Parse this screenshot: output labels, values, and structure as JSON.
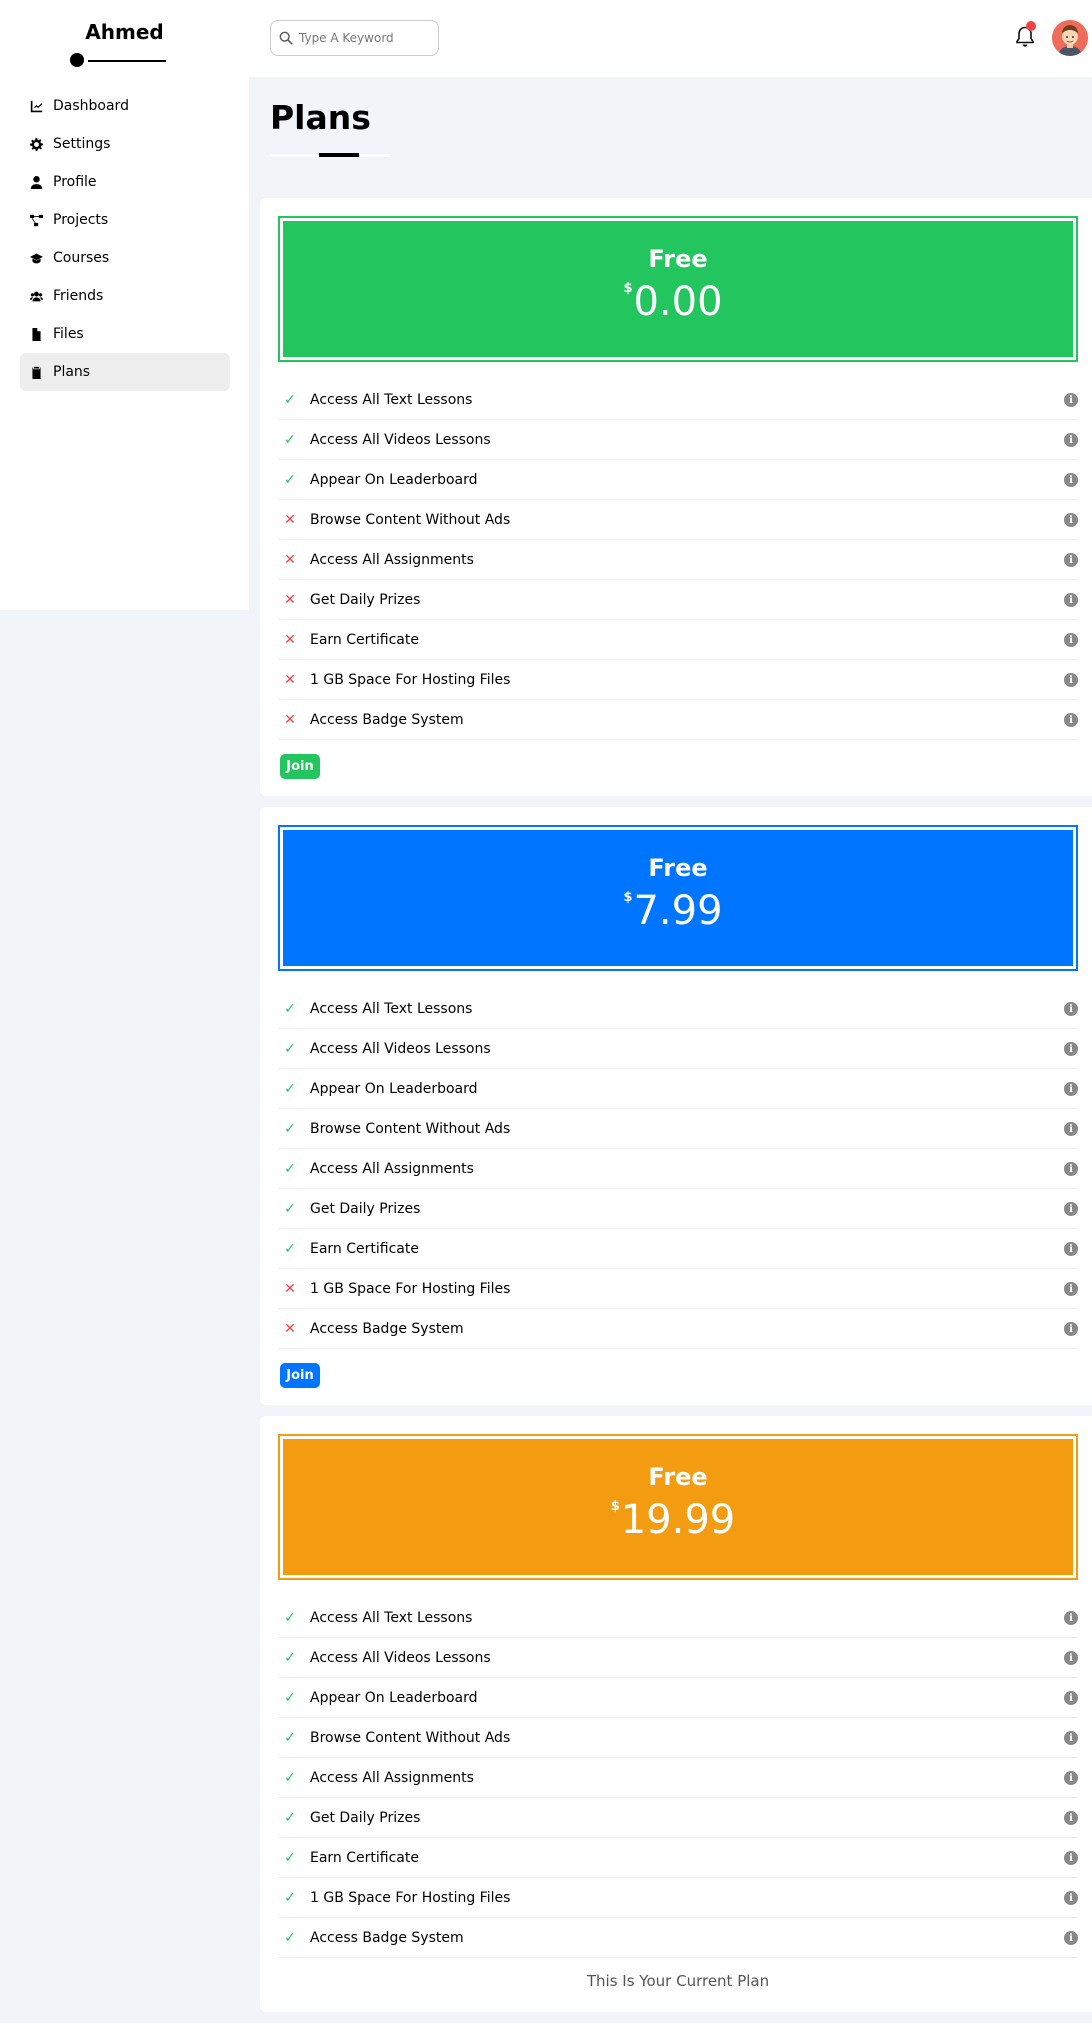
{
  "sidebar": {
    "brand": "Ahmed",
    "items": [
      {
        "label": "Dashboard",
        "icon": "chart-line-icon"
      },
      {
        "label": "Settings",
        "icon": "gear-icon"
      },
      {
        "label": "Profile",
        "icon": "user-icon"
      },
      {
        "label": "Projects",
        "icon": "diagram-icon"
      },
      {
        "label": "Courses",
        "icon": "graduation-cap-icon"
      },
      {
        "label": "Friends",
        "icon": "users-icon"
      },
      {
        "label": "Files",
        "icon": "file-icon"
      },
      {
        "label": "Plans",
        "icon": "clipboard-icon",
        "active": true
      }
    ]
  },
  "header": {
    "search_placeholder": "Type A Keyword",
    "notification_icon": "bell-icon",
    "avatar_icon": "avatar"
  },
  "main": {
    "title": "Plans",
    "plans": [
      {
        "name": "Free",
        "currency": "$",
        "price": "0.00",
        "color": "#22c55e",
        "features": [
          {
            "label": "Access All Text Lessons",
            "included": true
          },
          {
            "label": "Access All Videos Lessons",
            "included": true
          },
          {
            "label": "Appear On Leaderboard",
            "included": true
          },
          {
            "label": "Browse Content Without Ads",
            "included": false
          },
          {
            "label": "Access All Assignments",
            "included": false
          },
          {
            "label": "Get Daily Prizes",
            "included": false
          },
          {
            "label": "Earn Certificate",
            "included": false
          },
          {
            "label": "1 GB Space For Hosting Files",
            "included": false
          },
          {
            "label": "Access Badge System",
            "included": false
          }
        ],
        "action_label": "Join"
      },
      {
        "name": "Free",
        "currency": "$",
        "price": "7.99",
        "color": "#0075ff",
        "features": [
          {
            "label": "Access All Text Lessons",
            "included": true
          },
          {
            "label": "Access All Videos Lessons",
            "included": true
          },
          {
            "label": "Appear On Leaderboard",
            "included": true
          },
          {
            "label": "Browse Content Without Ads",
            "included": true
          },
          {
            "label": "Access All Assignments",
            "included": true
          },
          {
            "label": "Get Daily Prizes",
            "included": true
          },
          {
            "label": "Earn Certificate",
            "included": true
          },
          {
            "label": "1 GB Space For Hosting Files",
            "included": false
          },
          {
            "label": "Access Badge System",
            "included": false
          }
        ],
        "action_label": "Join"
      },
      {
        "name": "Free",
        "currency": "$",
        "price": "19.99",
        "color": "#f39c12",
        "features": [
          {
            "label": "Access All Text Lessons",
            "included": true
          },
          {
            "label": "Access All Videos Lessons",
            "included": true
          },
          {
            "label": "Appear On Leaderboard",
            "included": true
          },
          {
            "label": "Browse Content Without Ads",
            "included": true
          },
          {
            "label": "Access All Assignments",
            "included": true
          },
          {
            "label": "Get Daily Prizes",
            "included": true
          },
          {
            "label": "Earn Certificate",
            "included": true
          },
          {
            "label": "1 GB Space For Hosting Files",
            "included": true
          },
          {
            "label": "Access Badge System",
            "included": true
          }
        ],
        "current_label": "This Is Your Current Plan"
      }
    ]
  }
}
